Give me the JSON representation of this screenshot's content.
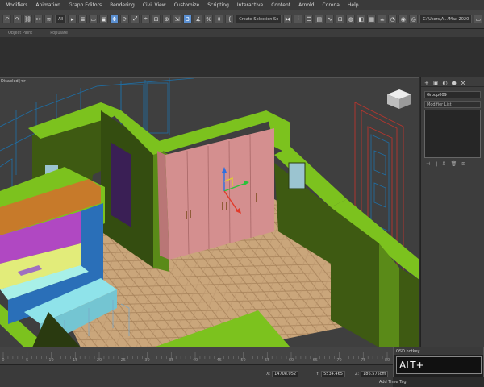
{
  "menubar": {
    "items": [
      "Modifiers",
      "Animation",
      "Graph Editors",
      "Rendering",
      "Civil View",
      "Customize",
      "Scripting",
      "Interactive",
      "Content",
      "Arnold",
      "Corona",
      "Help"
    ]
  },
  "toolbar": {
    "selection_filter": "All",
    "selection_set": "Create Selection Se",
    "workspace": "C:\\Users\\A...\\Max 2020"
  },
  "ribbon": {
    "object_paint": "Object Paint",
    "populate": "Populate"
  },
  "viewport": {
    "label": "Disabled]<>"
  },
  "command_panel": {
    "tabs": [
      "+",
      "▣",
      "◐",
      "●",
      "⚒"
    ],
    "object_name": "Group009",
    "modifier_list": "Modifier List"
  },
  "timeline": {
    "ticks": [
      0,
      5,
      10,
      15,
      20,
      25,
      30,
      35,
      40,
      45,
      50,
      55,
      60,
      65,
      70,
      75,
      80
    ]
  },
  "status": {
    "x_value": "1470e.052",
    "y_value": "5534.465",
    "z_value": "186.575cm",
    "add_time_tag": "Add Time Tag"
  },
  "osd": {
    "title": "OSD hotkey",
    "keys": "ALT+"
  },
  "colors": {
    "wall_green": "#7cc21e",
    "wall_dark": "#3e5a12",
    "wardrobe_pink": "#d48f8f",
    "floor_wood": "#c9a57a",
    "cabinet_blue": "#2a6fb8",
    "cabinet_purple": "#b048c2",
    "countertop_orange": "#c77a2a",
    "wire_blue": "#1e6fa6",
    "wire_red": "#b8362e"
  }
}
